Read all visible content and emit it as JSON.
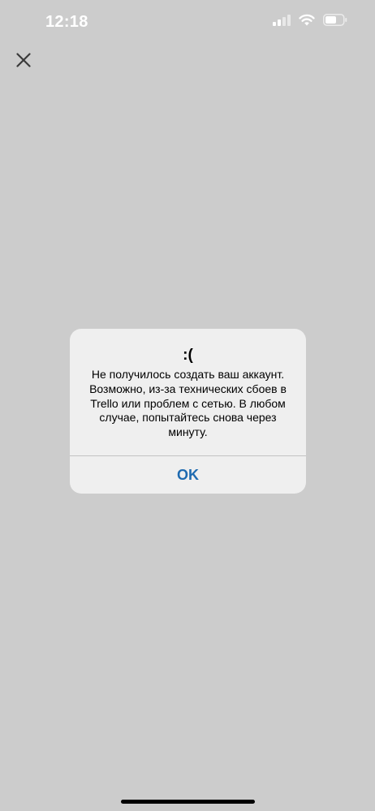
{
  "status_bar": {
    "time": "12:18",
    "icons": [
      "cellular-signal-icon",
      "wifi-icon",
      "battery-icon"
    ],
    "text_color": "#ffffff"
  },
  "nav": {
    "close_icon": "close-icon"
  },
  "alert": {
    "title": ":(",
    "message": "Не получилось создать ваш аккаунт. Возможно, из-за технических сбоев в Trello или проблем с сетью. В любом случае, попытайтесь снова через минуту.",
    "button_label": "OK",
    "button_color": "#1e6ab0",
    "background": "#efefef"
  },
  "colors": {
    "backdrop": "#cccccc"
  }
}
